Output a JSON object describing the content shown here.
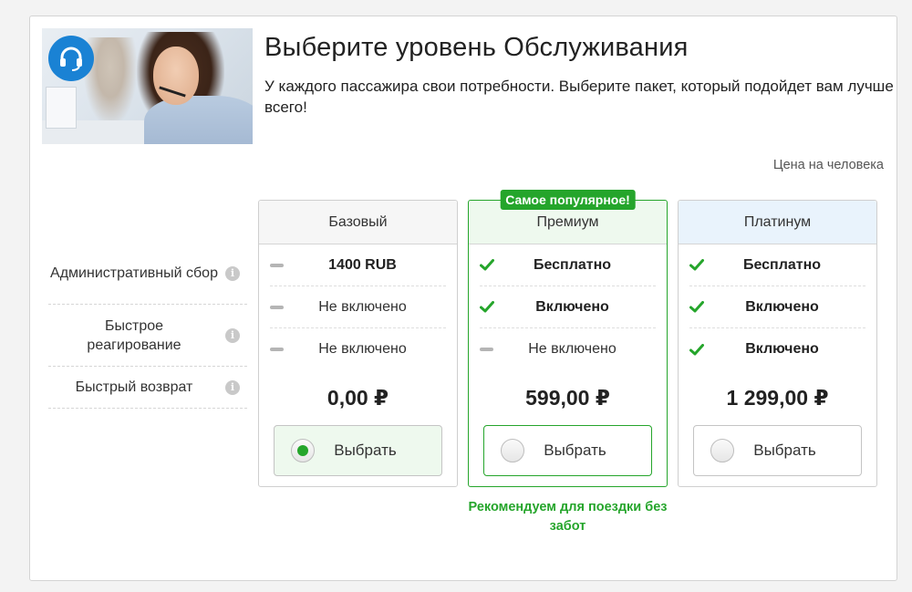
{
  "header": {
    "title": "Выберите уровень Обслуживания",
    "subtitle": "У каждого пассажира свои потребности. Выберите пакет, который подойдет вам лучше всего!"
  },
  "price_note": "Цена на человека",
  "features": [
    {
      "label": "Административный сбор"
    },
    {
      "label": "Быстрое реагирование"
    },
    {
      "label": "Быстрый возврат"
    }
  ],
  "plans": [
    {
      "name": "Базовый",
      "rows": [
        {
          "mark": "dash",
          "value": "1400 RUB",
          "bold": true
        },
        {
          "mark": "dash",
          "value": "Не включено",
          "bold": false
        },
        {
          "mark": "dash",
          "value": "Не включено",
          "bold": false
        }
      ],
      "price": "0,00 ₽",
      "button": "Выбрать",
      "selected": true
    },
    {
      "name": "Премиум",
      "tag": "Самое популярное!",
      "rows": [
        {
          "mark": "check",
          "value": "Бесплатно",
          "bold": true
        },
        {
          "mark": "check",
          "value": "Включено",
          "bold": true
        },
        {
          "mark": "dash",
          "value": "Не включено",
          "bold": false
        }
      ],
      "price": "599,00 ₽",
      "button": "Выбрать",
      "selected": false,
      "recommend": "Рекомендуем для поездки без забот"
    },
    {
      "name": "Платинум",
      "rows": [
        {
          "mark": "check",
          "value": "Бесплатно",
          "bold": true
        },
        {
          "mark": "check",
          "value": "Включено",
          "bold": true
        },
        {
          "mark": "check",
          "value": "Включено",
          "bold": true
        }
      ],
      "price": "1 299,00 ₽",
      "button": "Выбрать",
      "selected": false
    }
  ],
  "colors": {
    "accent": "#25a52b",
    "badge": "#1a82d4"
  },
  "icons": {
    "hero_badge": "headset-icon",
    "info": "info-icon",
    "included": "check-icon",
    "not_included": "dash-icon"
  }
}
